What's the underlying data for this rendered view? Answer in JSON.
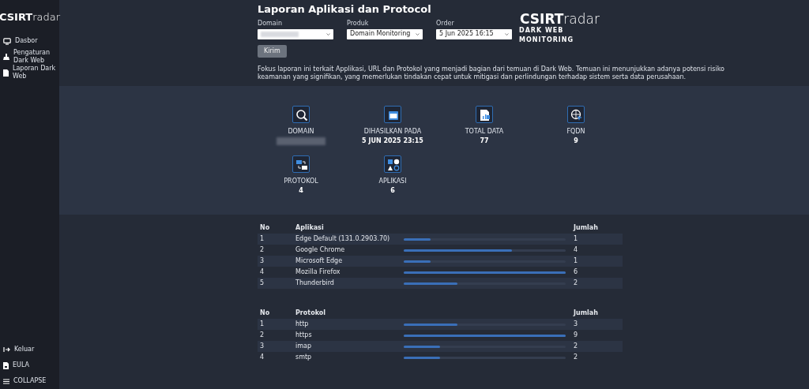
{
  "sidebar": {
    "logo": {
      "bold": "CSIRT",
      "light": "radar"
    },
    "items": [
      {
        "label": "Dasbor"
      },
      {
        "label": "Pengaturan Dark Web"
      },
      {
        "label": "Laporan Dark Web"
      }
    ],
    "bottom_items": [
      {
        "label": "Keluar"
      },
      {
        "label": "EULA"
      },
      {
        "label": "COLLAPSE"
      }
    ]
  },
  "header": {
    "title": "Laporan Aplikasi dan Protocol",
    "fields": [
      {
        "label": "Domain",
        "redacted": true
      },
      {
        "label": "Produk",
        "value": "Domain Monitoring"
      },
      {
        "label": "Order",
        "value": "5 Jun 2025 16:15"
      }
    ],
    "submit": "Kirim",
    "logo": {
      "bold": "CSIRT",
      "light": "radar",
      "tagline": "DARK WEB MONITORING"
    }
  },
  "description": "Fokus laporan ini terkait Applikasi, URL dan Protokol yang menjadi bagian dari temuan di Dark Web. Temuan ini menunjukkan adanya potensi risiko keamanan yang signifikan, yang memerlukan tindakan cepat untuk mitigasi dan perlindungan terhadap sistem serta data perusahaan.",
  "stats": [
    {
      "label": "DOMAIN",
      "redacted": true
    },
    {
      "label": "DIHASILKAN PADA",
      "value": "5 JUN 2025 23:15"
    },
    {
      "label": "TOTAL DATA",
      "value": "77"
    },
    {
      "label": "FQDN",
      "value": "9"
    },
    {
      "label": "PROTOKOL",
      "value": "4"
    },
    {
      "label": "APLIKASI",
      "value": "6"
    }
  ],
  "tables": [
    {
      "columns": [
        "No",
        "Aplikasi",
        "Jumlah"
      ],
      "rows": [
        {
          "no": "1",
          "name": "Edge Default (131.0.2903.70)",
          "level": 0.167,
          "count": "1"
        },
        {
          "no": "2",
          "name": "Google Chrome",
          "level": 0.667,
          "count": "4"
        },
        {
          "no": "3",
          "name": "Microsoft Edge",
          "level": 0.167,
          "count": "1"
        },
        {
          "no": "4",
          "name": "Mozilla Firefox",
          "level": 1,
          "count": "6"
        },
        {
          "no": "5",
          "name": "Thunderbird",
          "level": 0.333,
          "count": "2"
        }
      ]
    },
    {
      "columns": [
        "No",
        "Protokol",
        "Jumlah"
      ],
      "rows": [
        {
          "no": "1",
          "name": "http",
          "level": 0.333,
          "count": "3"
        },
        {
          "no": "2",
          "name": "https",
          "level": 1,
          "count": "9"
        },
        {
          "no": "3",
          "name": "imap",
          "level": 0.222,
          "count": "2"
        },
        {
          "no": "4",
          "name": "smtp",
          "level": 0.222,
          "count": "2"
        }
      ]
    }
  ]
}
